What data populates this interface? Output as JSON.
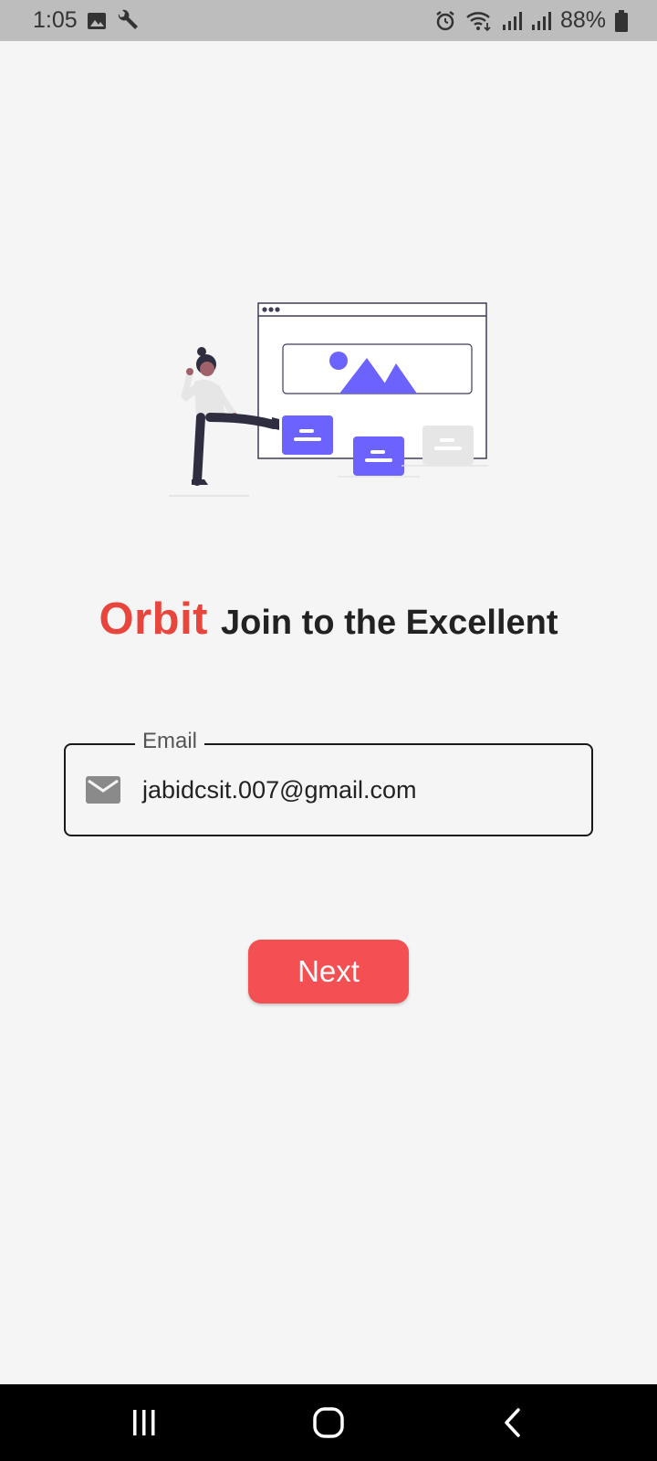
{
  "status_bar": {
    "time": "1:05",
    "battery": "88%",
    "icons": [
      "image-icon",
      "wrench-icon",
      "alarm-icon",
      "wifi-icon",
      "signal-icon",
      "signal-icon",
      "battery-icon"
    ]
  },
  "header": {
    "brand": "Orbit",
    "tagline": "Join to the Excellent"
  },
  "form": {
    "email_label": "Email",
    "email_value": "jabidcsit.007@gmail.com"
  },
  "actions": {
    "next_label": "Next"
  },
  "colors": {
    "brand": "#e8453c",
    "button": "#f44f52",
    "illustration_accent": "#6c63ff"
  },
  "nav_bar": {
    "icons": [
      "recents-icon",
      "home-icon",
      "back-icon"
    ]
  }
}
